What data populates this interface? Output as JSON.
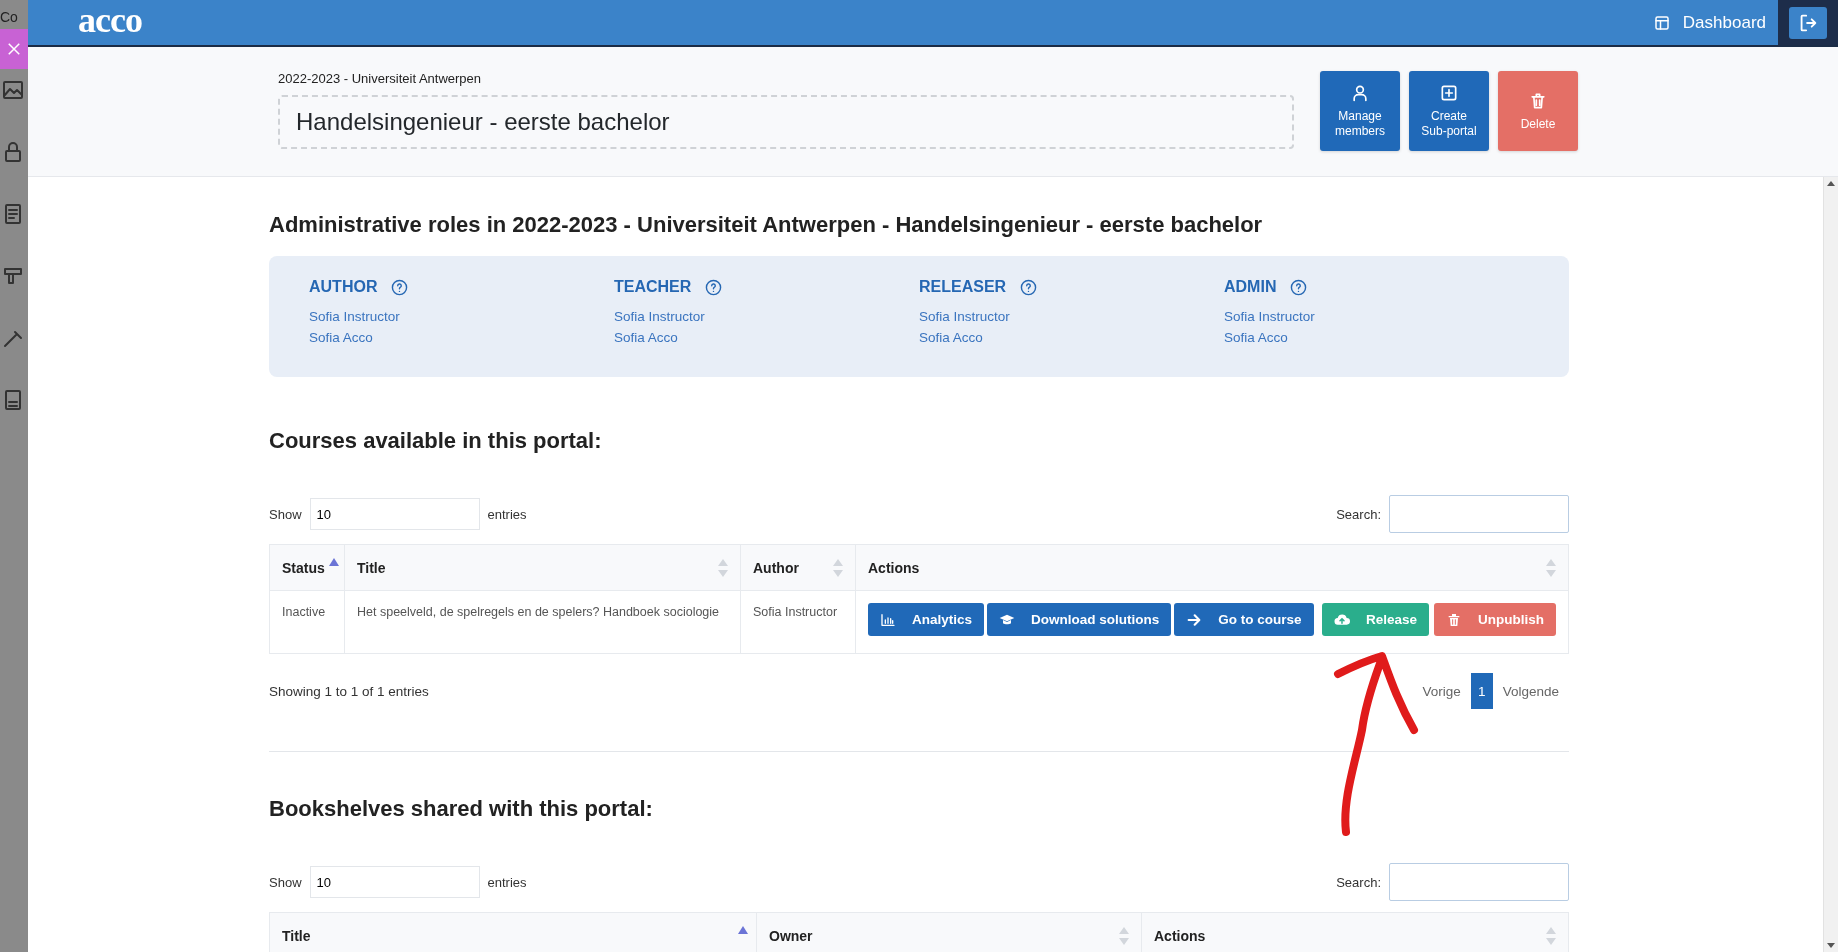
{
  "side_strip": {
    "label": "Co"
  },
  "header": {
    "logo": "acco",
    "nav_link": "Dashboard"
  },
  "portal": {
    "breadcrumb": "2022-2023 - Universiteit Antwerpen",
    "title": "Handelsingenieur - eerste bachelor",
    "buttons": [
      {
        "kind": "members",
        "label": "Manage\nmembers"
      },
      {
        "kind": "create",
        "label": "Create\nSub-portal"
      },
      {
        "kind": "delete",
        "label": "Delete"
      }
    ]
  },
  "roles": {
    "heading": "Administrative roles in 2022-2023 - Universiteit Antwerpen - Handelsingenieur - eerste bachelor",
    "groups": [
      {
        "name": "AUTHOR",
        "members": [
          "Sofia Instructor",
          "Sofia Acco"
        ]
      },
      {
        "name": "TEACHER",
        "members": [
          "Sofia Instructor",
          "Sofia Acco"
        ]
      },
      {
        "name": "RELEASER",
        "members": [
          "Sofia Instructor",
          "Sofia Acco"
        ]
      },
      {
        "name": "ADMIN",
        "members": [
          "Sofia Instructor",
          "Sofia Acco"
        ]
      }
    ]
  },
  "courses": {
    "heading": "Courses available in this portal:",
    "show_label": "Show",
    "page_size": "10",
    "entries_label": "entries",
    "search_label": "Search:",
    "columns": [
      {
        "label": "Status",
        "sorted_ascending": true
      },
      {
        "label": "Title",
        "sorted_ascending": false
      },
      {
        "label": "Author",
        "sorted_ascending": false
      },
      {
        "label": "Actions",
        "sorted_ascending": false
      }
    ],
    "rows": [
      {
        "status": "Inactive",
        "title": "Het speelveld, de spelregels en de spelers? Handboek sociologie",
        "author": "Sofia Instructor",
        "actions": [
          {
            "kind": "analytics",
            "label": "Analytics"
          },
          {
            "kind": "download",
            "label": "Download solutions"
          },
          {
            "kind": "goto",
            "label": "Go to course"
          },
          {
            "kind": "release",
            "label": "Release"
          },
          {
            "kind": "unpublish",
            "label": "Unpublish"
          }
        ]
      }
    ],
    "info": "Showing 1 to 1 of 1 entries",
    "pagination": [
      {
        "label": "Vorige",
        "kind": "prev",
        "selected": false
      },
      {
        "label": "1",
        "kind": "page",
        "selected": true
      },
      {
        "label": "Volgende",
        "kind": "next",
        "selected": false
      }
    ]
  },
  "bookshelves": {
    "heading": "Bookshelves shared with this portal:",
    "show_label": "Show",
    "page_size": "10",
    "entries_label": "entries",
    "search_label": "Search:",
    "columns": [
      {
        "label": "Title",
        "sorted_ascending": true
      },
      {
        "label": "Owner",
        "sorted_ascending": false
      },
      {
        "label": "Actions",
        "sorted_ascending": false
      }
    ]
  },
  "annotations": [
    {
      "kind": "arrow",
      "color": "#e01b1b"
    }
  ]
}
